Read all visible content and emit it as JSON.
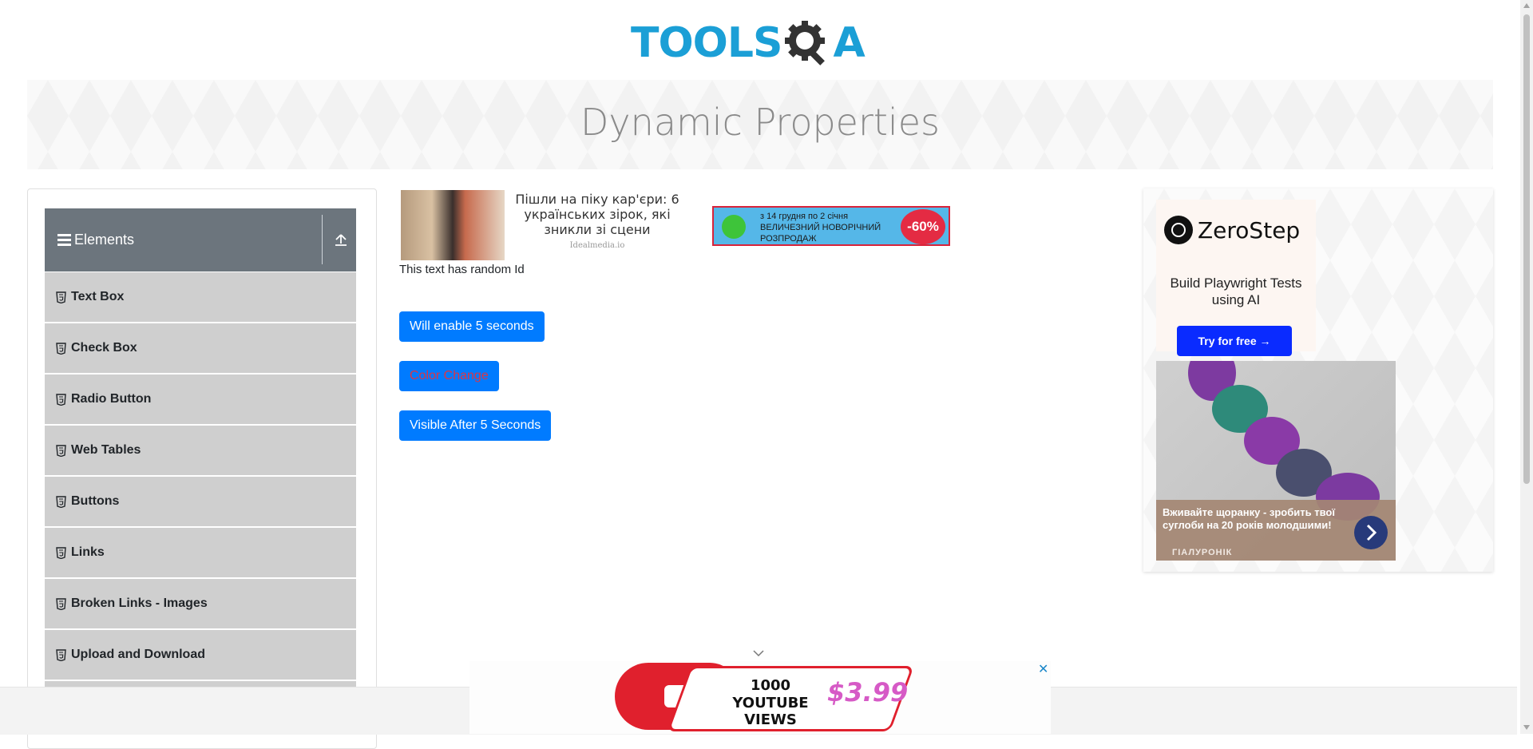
{
  "site": {
    "logo_left": "TOOLS",
    "logo_right": "A"
  },
  "page": {
    "title": "Dynamic Properties"
  },
  "sidebar": {
    "group_title": "Elements",
    "items": [
      {
        "label": "Text Box"
      },
      {
        "label": "Check Box"
      },
      {
        "label": "Radio Button"
      },
      {
        "label": "Web Tables"
      },
      {
        "label": "Buttons"
      },
      {
        "label": "Links"
      },
      {
        "label": "Broken Links - Images"
      },
      {
        "label": "Upload and Download"
      }
    ]
  },
  "ad_top": {
    "headline": "Пішли на піку кар'єри: 6 українських зірок, які зникли зі сцени",
    "source": "Idealmedia.io"
  },
  "promo_banner": {
    "line1": "з 14 грудня по 2 січня",
    "line2": "ВЕЛИЧЕЗНИЙ НОВОРІЧНИЙ",
    "line3": "РОЗПРОДАЖ",
    "discount": "-60%"
  },
  "main": {
    "random_id_text": "This text has random Id",
    "enable_button": "Will enable 5 seconds",
    "color_button": "Color Change",
    "visible_button": "Visible After 5 Seconds"
  },
  "zerostep_ad": {
    "brand": "ZeroStep",
    "tagline": "Build Playwright Tests using AI",
    "cta": "Try for free →"
  },
  "sponsor_ad": {
    "text": "Вживайте щоранку - зробить твої суглоби на 20 років молодшими!",
    "brand": "ГІАЛУРОНІК"
  },
  "bottom_ad": {
    "line1": "1000",
    "line2": "YOUTUBE VIEWS",
    "price": "$3.99",
    "close": "✕"
  },
  "colors": {
    "primary_button": "#007bff",
    "color_change_text": "#dc3545",
    "sidebar_header": "#6c757d",
    "menu_item_bg": "#cfcfcf",
    "logo_blue": "#1b9fd6"
  }
}
